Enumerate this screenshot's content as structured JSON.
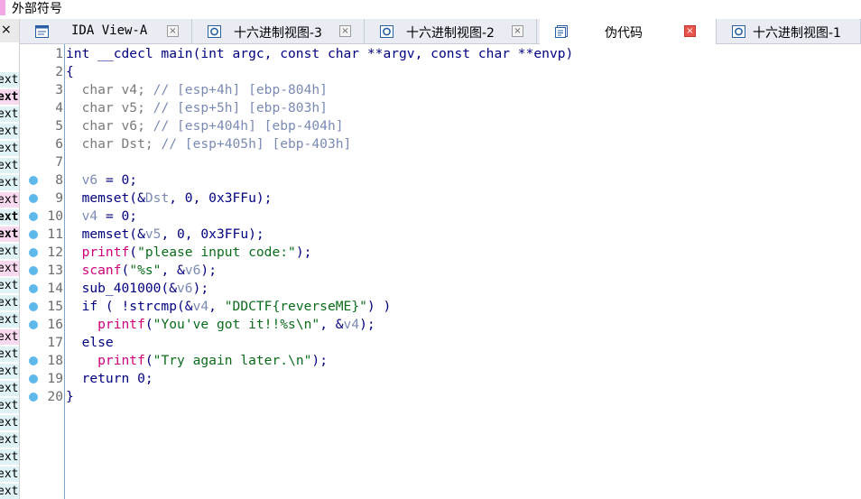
{
  "external_symbols": {
    "label": "外部符号"
  },
  "left_panel": {
    "close_glyph": "×",
    "rows": [
      {
        "text": "ext",
        "highlight": "#dff3f7",
        "bold": false
      },
      {
        "text": "ext",
        "highlight": "#f9d9ef",
        "bold": true
      },
      {
        "text": "ext",
        "highlight": "#dff3f7",
        "bold": false
      },
      {
        "text": "ext",
        "highlight": "#dff3f7",
        "bold": false
      },
      {
        "text": "ext",
        "highlight": "#dff3f7",
        "bold": false
      },
      {
        "text": "ext",
        "highlight": "#dff3f7",
        "bold": false
      },
      {
        "text": "ext",
        "highlight": "#dff3f7",
        "bold": false
      },
      {
        "text": "ext",
        "highlight": "#f9d9ef",
        "bold": false
      },
      {
        "text": "ext",
        "highlight": "#dff3f7",
        "bold": true
      },
      {
        "text": "ext",
        "highlight": "#f9d9ef",
        "bold": true
      },
      {
        "text": "ext",
        "highlight": "#dff3f7",
        "bold": false
      },
      {
        "text": "ext",
        "highlight": "#f9d9ef",
        "bold": false
      },
      {
        "text": "ext",
        "highlight": "#dff3f7",
        "bold": false
      },
      {
        "text": "ext",
        "highlight": "#dff3f7",
        "bold": false
      },
      {
        "text": "ext",
        "highlight": "#dff3f7",
        "bold": false
      },
      {
        "text": "ext",
        "highlight": "#f9d9ef",
        "bold": false
      },
      {
        "text": "ext",
        "highlight": "#dff3f7",
        "bold": false
      },
      {
        "text": "ext",
        "highlight": "#dff3f7",
        "bold": false
      },
      {
        "text": "ext",
        "highlight": "#dff3f7",
        "bold": false
      },
      {
        "text": "ext",
        "highlight": "#dff3f7",
        "bold": false
      },
      {
        "text": "ext",
        "highlight": "#dff3f7",
        "bold": false
      },
      {
        "text": "ext",
        "highlight": "#dff3f7",
        "bold": false
      },
      {
        "text": "ext",
        "highlight": "#dff3f7",
        "bold": false
      },
      {
        "text": "ext",
        "highlight": "#dff3f7",
        "bold": false
      },
      {
        "text": "ext",
        "highlight": "#dff3f7",
        "bold": false
      }
    ]
  },
  "tabs": [
    {
      "label": "IDA View-A",
      "icon": "ida-view-icon",
      "close": "×",
      "active": false
    },
    {
      "label": "十六进制视图-3",
      "icon": "hex-view-icon",
      "close": "×",
      "active": false
    },
    {
      "label": "十六进制视图-2",
      "icon": "hex-view-icon",
      "close": "×",
      "active": false
    },
    {
      "label": "伪代码",
      "icon": "pseudocode-icon",
      "close": "×",
      "active": true
    },
    {
      "label": "十六进制视图-1",
      "icon": "hex-view-icon",
      "close": "",
      "active": false
    }
  ],
  "colors": {
    "keyword": "#000080",
    "comment": "#7b8ab5",
    "function": "#d0007a",
    "string": "#0b6c1c",
    "breakpoint_dot": "#5fb8ea",
    "active_tab_close": "#e9544b"
  },
  "code_lines": [
    {
      "n": "1",
      "bp": false,
      "tokens": [
        [
          "kw",
          "int __cdecl main(int argc, const char **argv, const char **envp)"
        ]
      ]
    },
    {
      "n": "2",
      "bp": false,
      "tokens": [
        [
          "kw",
          "{"
        ]
      ]
    },
    {
      "n": "3",
      "bp": false,
      "tokens": [
        [
          "gray",
          "  char v4; "
        ],
        [
          "cmt",
          "// [esp+4h] [ebp-804h]"
        ]
      ]
    },
    {
      "n": "4",
      "bp": false,
      "tokens": [
        [
          "gray",
          "  char v5; "
        ],
        [
          "cmt",
          "// [esp+5h] [ebp-803h]"
        ]
      ]
    },
    {
      "n": "5",
      "bp": false,
      "tokens": [
        [
          "gray",
          "  char v6; "
        ],
        [
          "cmt",
          "// [esp+404h] [ebp-404h]"
        ]
      ]
    },
    {
      "n": "6",
      "bp": false,
      "tokens": [
        [
          "gray",
          "  char Dst; "
        ],
        [
          "cmt",
          "// [esp+405h] [ebp-403h]"
        ]
      ]
    },
    {
      "n": "7",
      "bp": false,
      "tokens": [
        [
          "kw",
          ""
        ]
      ]
    },
    {
      "n": "8",
      "bp": true,
      "tokens": [
        [
          "cmt",
          "  v6"
        ],
        [
          "kw",
          " = 0;"
        ]
      ]
    },
    {
      "n": "9",
      "bp": true,
      "tokens": [
        [
          "kw",
          "  memset(&"
        ],
        [
          "cmt",
          "Dst"
        ],
        [
          "kw",
          ", 0, 0x3FFu);"
        ]
      ]
    },
    {
      "n": "10",
      "bp": true,
      "tokens": [
        [
          "cmt",
          "  v4"
        ],
        [
          "kw",
          " = 0;"
        ]
      ]
    },
    {
      "n": "11",
      "bp": true,
      "tokens": [
        [
          "kw",
          "  memset(&"
        ],
        [
          "cmt",
          "v5"
        ],
        [
          "kw",
          ", 0, 0x3FFu);"
        ]
      ]
    },
    {
      "n": "12",
      "bp": true,
      "tokens": [
        [
          "fn",
          "  printf"
        ],
        [
          "kw",
          "(\"please input code:\");"
        ]
      ]
    },
    {
      "n": "13",
      "bp": true,
      "tokens": [
        [
          "fn",
          "  scanf"
        ],
        [
          "kw",
          "(\"%s\", &"
        ],
        [
          "cmt",
          "v6"
        ],
        [
          "kw",
          ");"
        ]
      ]
    },
    {
      "n": "14",
      "bp": true,
      "tokens": [
        [
          "kw",
          "  sub_401000(&"
        ],
        [
          "cmt",
          "v6"
        ],
        [
          "kw",
          ");"
        ]
      ]
    },
    {
      "n": "15",
      "bp": true,
      "tokens": [
        [
          "kw",
          "  if ( !strcmp(&"
        ],
        [
          "cmt",
          "v4"
        ],
        [
          "kw",
          ", \"DDCTF{reverseME}\") )"
        ]
      ]
    },
    {
      "n": "16",
      "bp": true,
      "tokens": [
        [
          "fn",
          "    printf"
        ],
        [
          "kw",
          "(\"You've got it!!%s\\n\", &"
        ],
        [
          "cmt",
          "v4"
        ],
        [
          "kw",
          ");"
        ]
      ]
    },
    {
      "n": "17",
      "bp": false,
      "tokens": [
        [
          "kw",
          "  else"
        ]
      ]
    },
    {
      "n": "18",
      "bp": true,
      "tokens": [
        [
          "fn",
          "    printf"
        ],
        [
          "kw",
          "(\"Try again later.\\n\");"
        ]
      ]
    },
    {
      "n": "19",
      "bp": true,
      "tokens": [
        [
          "kw",
          "  return 0;"
        ]
      ]
    },
    {
      "n": "20",
      "bp": true,
      "tokens": [
        [
          "kw",
          "}"
        ]
      ]
    }
  ]
}
